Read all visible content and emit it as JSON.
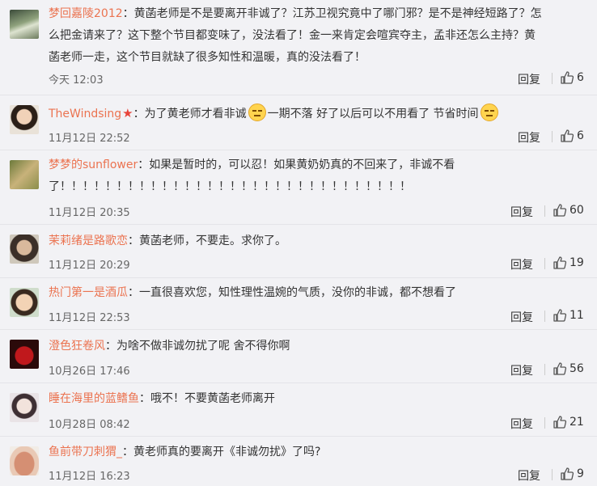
{
  "reply_label": "回复",
  "comments": [
    {
      "user": "梦回嘉陵2012",
      "text": "黄菡老师是不是要离开非诚了？江苏卫视究竟中了哪门邪？是不是神经短路了？怎么把金请来了？这下整个节目都变味了，没法看了！金一来肯定会喧宾夺主，孟非还怎么主持？黄菡老师一走，这个节目就缺了很多知性和温暖，真的没法看了！",
      "time": "今天 12:03",
      "likes": "6"
    },
    {
      "user": "TheWindsing",
      "text_a": "为了黄老师才看非诚",
      "text_b": "一期不落 好了以后可以不用看了 节省时间",
      "time": "11月12日 22:52",
      "likes": "6"
    },
    {
      "user": "梦梦的sunflower",
      "text": "如果是暂时的，可以忍！如果黄奶奶真的不回来了，非诚不看了！！！！！！！！！！！！！！！！！！！！！！！！！！！！！！！",
      "time": "11月12日 20:35",
      "likes": "60"
    },
    {
      "user": "茉莉绪是路歌恋",
      "text": "黄菡老师，不要走。求你了。",
      "time": "11月12日 20:29",
      "likes": "19"
    },
    {
      "user": "热门第一是酒瓜",
      "text": "一直很喜欢您，知性理性温婉的气质，没你的非诚，都不想看了",
      "time": "11月12日 22:53",
      "likes": "11"
    },
    {
      "user": "澄色狂卷风",
      "text": "为啥不做非诚勿扰了呢 舍不得你啊",
      "time": "10月26日 17:46",
      "likes": "56"
    },
    {
      "user": "睡在海里的蓝鳍鱼",
      "text": "哦不！不要黄菡老师离开",
      "time": "10月28日 08:42",
      "likes": "21"
    },
    {
      "user": "鱼前带刀刺猬_",
      "text": "黄老师真的要离开《非诚勿扰》了吗?",
      "time": "11月12日 16:23",
      "likes": "9"
    }
  ],
  "colors": {
    "username": "#eb7350",
    "background": "#f2f2f5"
  },
  "icons": {
    "like": "thumbs-up-icon",
    "badge": "red-star-badge-icon",
    "emoji": "smiley-emoji-icon"
  }
}
